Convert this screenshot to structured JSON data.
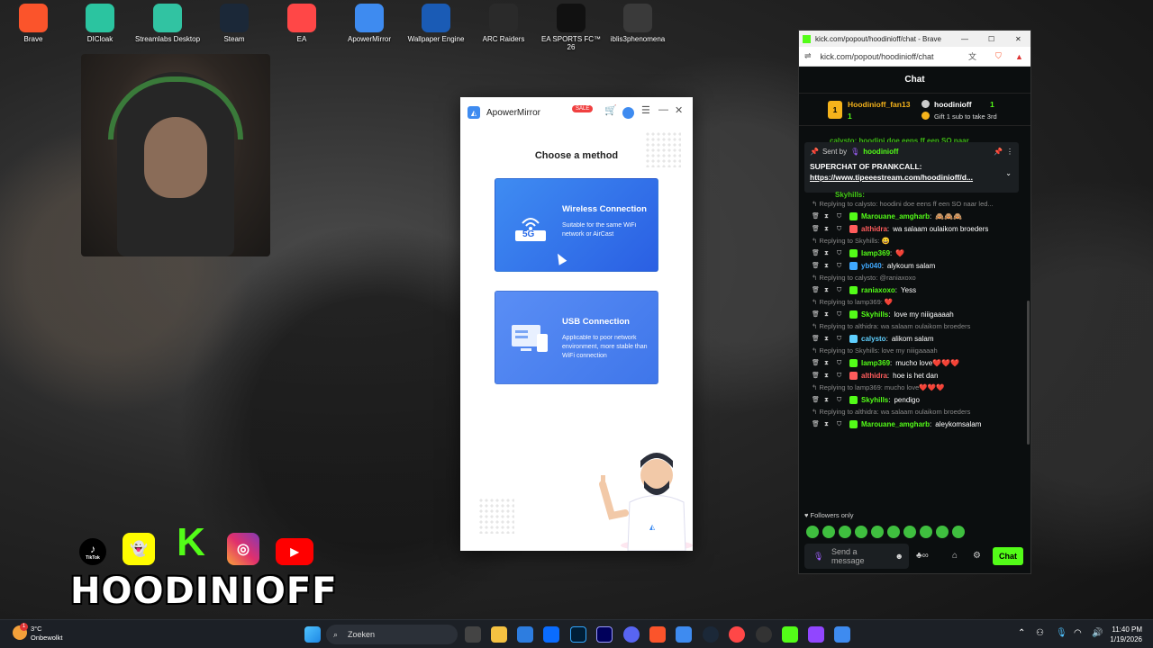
{
  "desktop": {
    "icons": [
      {
        "label": "Brave",
        "icon": "brave-icon",
        "color": "#fb542b"
      },
      {
        "label": "DICloak",
        "icon": "dicloak-icon",
        "color": "#2bc4a0"
      },
      {
        "label": "Streamlabs Desktop",
        "icon": "streamlabs-icon",
        "color": "#31c3a2"
      },
      {
        "label": "Steam",
        "icon": "steam-icon",
        "color": "#1b2838"
      },
      {
        "label": "EA",
        "icon": "ea-icon",
        "color": "#ff4747"
      },
      {
        "label": "ApowerMirror",
        "icon": "apowermirror-icon",
        "color": "#3e8bf0"
      },
      {
        "label": "Wallpaper Engine",
        "icon": "wallpaper-engine-icon",
        "color": "#1a5bb5"
      },
      {
        "label": "ARC Raiders",
        "icon": "arc-raiders-icon",
        "color": "#2a2a2a"
      },
      {
        "label": "EA SPORTS FC™ 26",
        "icon": "ea-fc-icon",
        "color": "#111111"
      },
      {
        "label": "iblis3phenomena",
        "icon": "iblis-icon",
        "color": "#3a3a3a"
      }
    ]
  },
  "overlay": {
    "brand": "HOODINIOFF",
    "tiktok_label": "TikTok"
  },
  "apowermirror": {
    "title": "ApowerMirror",
    "sale": "SALE",
    "heading": "Choose a method",
    "wireless": {
      "title": "Wireless Connection",
      "desc": "Suitable for the same WiFi network or AirCast",
      "badge": "5G"
    },
    "usb": {
      "title": "USB Connection",
      "desc": "Applicable to poor network environment, more stable than WiFi connection"
    }
  },
  "browser": {
    "tab_title": "kick.com/popout/hoodinioff/chat - Brave",
    "url": "kick.com/popout/hoodinioff/chat"
  },
  "chat": {
    "header": "Chat",
    "leader": {
      "rank": "1",
      "name": "Hoodinioff_fan13",
      "count": "1",
      "streamer": "hoodinioff",
      "gift_count": "1",
      "gift_text": "Gift 1 sub to take 3rd"
    },
    "pinned": {
      "sent_by_label": "Sent by",
      "sent_by_user": "hoodinioff",
      "title": "SUPERCHAT OF PRANKCALL:",
      "link": "https://www.tipeeestream.com/hoodinioff/d...",
      "behind": "calysto: hoodini doe eens ff een SO naar",
      "behind2": "Skyhills:"
    },
    "messages": [
      {
        "reply": "Replying to calysto: hoodini doe eens ff een SO naar led...",
        "user": "Marouane_amgharb",
        "color": "#53fc18",
        "text": "🙈🙈🙈"
      },
      {
        "reply": "",
        "user": "althidra",
        "color": "#ff5c5c",
        "text": "wa salaam oulaikom broeders"
      },
      {
        "reply": "Replying to Skyhills: 😀",
        "user": "lamp369",
        "color": "#53fc18",
        "text": "❤️"
      },
      {
        "reply": "",
        "user": "yb040",
        "color": "#3fa9ff",
        "text": "alykoum salam"
      },
      {
        "reply": "Replying to calysto: @raniaxoxo",
        "user": "raniaxoxo",
        "color": "#53fc18",
        "text": "Yess"
      },
      {
        "reply": "Replying to lamp369: ❤️",
        "user": "Skyhills",
        "color": "#53fc18",
        "text": "love my niiigaaaah"
      },
      {
        "reply": "Replying to althidra: wa salaam oulaikom broeders",
        "user": "calysto",
        "color": "#5fd0ff",
        "text": "alikom salam"
      },
      {
        "reply": "Replying to Skyhills: love my niiigaaaah",
        "user": "lamp369",
        "color": "#53fc18",
        "text": "mucho love❤️❤️❤️"
      },
      {
        "reply": "",
        "user": "althidra",
        "color": "#ff5c5c",
        "text": "hoe is het dan"
      },
      {
        "reply": "Replying to lamp369: mucho love❤️❤️❤️",
        "user": "Skyhills",
        "color": "#53fc18",
        "text": "pendigo"
      },
      {
        "reply": "Replying to althidra: wa salaam oulaikom broeders",
        "user": "Marouane_amgharb",
        "color": "#53fc18",
        "text": "aleykomsalam"
      }
    ],
    "followers_only": "Followers only",
    "input_placeholder": "Send a message",
    "send_label": "Chat"
  },
  "taskbar": {
    "weather_temp": "3°C",
    "weather_desc": "Onbewolkt",
    "weather_badge": "1",
    "search_placeholder": "Zoeken",
    "time": "11:40 PM",
    "date": "1/19/2026"
  }
}
